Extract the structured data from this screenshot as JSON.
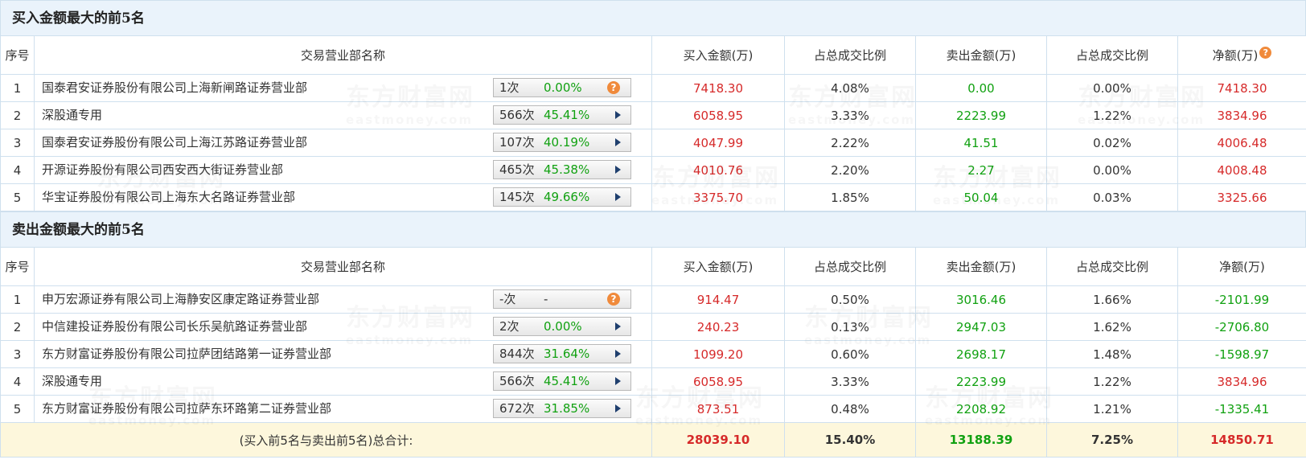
{
  "watermark": {
    "cn": "东方财富网",
    "en": "eastmoney.com"
  },
  "buy": {
    "title": "买入金额最大的前5名",
    "headers": [
      "序号",
      "交易营业部名称",
      "买入金额(万)",
      "占总成交比例",
      "卖出金额(万)",
      "占总成交比例",
      "净额(万)"
    ],
    "rows": [
      {
        "idx": "1",
        "name": "国泰君安证券股份有限公司上海新闸路证券营业部",
        "count": "1次",
        "pct": "0.00%",
        "buy": "7418.30",
        "buy_ratio": "4.08%",
        "sell": "0.00",
        "sell_ratio": "0.00%",
        "net": "7418.30"
      },
      {
        "idx": "2",
        "name": "深股通专用",
        "count": "566次",
        "pct": "45.41%",
        "buy": "6058.95",
        "buy_ratio": "3.33%",
        "sell": "2223.99",
        "sell_ratio": "1.22%",
        "net": "3834.96"
      },
      {
        "idx": "3",
        "name": "国泰君安证券股份有限公司上海江苏路证券营业部",
        "count": "107次",
        "pct": "40.19%",
        "buy": "4047.99",
        "buy_ratio": "2.22%",
        "sell": "41.51",
        "sell_ratio": "0.02%",
        "net": "4006.48"
      },
      {
        "idx": "4",
        "name": "开源证券股份有限公司西安西大街证券营业部",
        "count": "465次",
        "pct": "45.38%",
        "buy": "4010.76",
        "buy_ratio": "2.20%",
        "sell": "2.27",
        "sell_ratio": "0.00%",
        "net": "4008.48"
      },
      {
        "idx": "5",
        "name": "华宝证券股份有限公司上海东大名路证券营业部",
        "count": "145次",
        "pct": "49.66%",
        "buy": "3375.70",
        "buy_ratio": "1.85%",
        "sell": "50.04",
        "sell_ratio": "0.03%",
        "net": "3325.66"
      }
    ]
  },
  "sell": {
    "title": "卖出金额最大的前5名",
    "headers": [
      "序号",
      "交易营业部名称",
      "买入金额(万)",
      "占总成交比例",
      "卖出金额(万)",
      "占总成交比例",
      "净额(万)"
    ],
    "rows": [
      {
        "idx": "1",
        "name": "申万宏源证券有限公司上海静安区康定路证券营业部",
        "count": "-次",
        "pct": "-",
        "buy": "914.47",
        "buy_ratio": "0.50%",
        "sell": "3016.46",
        "sell_ratio": "1.66%",
        "net": "-2101.99"
      },
      {
        "idx": "2",
        "name": "中信建投证券股份有限公司长乐吴航路证券营业部",
        "count": "2次",
        "pct": "0.00%",
        "buy": "240.23",
        "buy_ratio": "0.13%",
        "sell": "2947.03",
        "sell_ratio": "1.62%",
        "net": "-2706.80"
      },
      {
        "idx": "3",
        "name": "东方财富证券股份有限公司拉萨团结路第一证券营业部",
        "count": "844次",
        "pct": "31.64%",
        "buy": "1099.20",
        "buy_ratio": "0.60%",
        "sell": "2698.17",
        "sell_ratio": "1.48%",
        "net": "-1598.97"
      },
      {
        "idx": "4",
        "name": "深股通专用",
        "count": "566次",
        "pct": "45.41%",
        "buy": "6058.95",
        "buy_ratio": "3.33%",
        "sell": "2223.99",
        "sell_ratio": "1.22%",
        "net": "3834.96"
      },
      {
        "idx": "5",
        "name": "东方财富证券股份有限公司拉萨东环路第二证券营业部",
        "count": "672次",
        "pct": "31.85%",
        "buy": "873.51",
        "buy_ratio": "0.48%",
        "sell": "2208.92",
        "sell_ratio": "1.21%",
        "net": "-1335.41"
      }
    ]
  },
  "total": {
    "label": "(买入前5名与卖出前5名)总合计:",
    "buy": "28039.10",
    "buy_ratio": "15.40%",
    "sell": "13188.39",
    "sell_ratio": "7.25%",
    "net": "14850.71"
  },
  "help_glyph": "?"
}
